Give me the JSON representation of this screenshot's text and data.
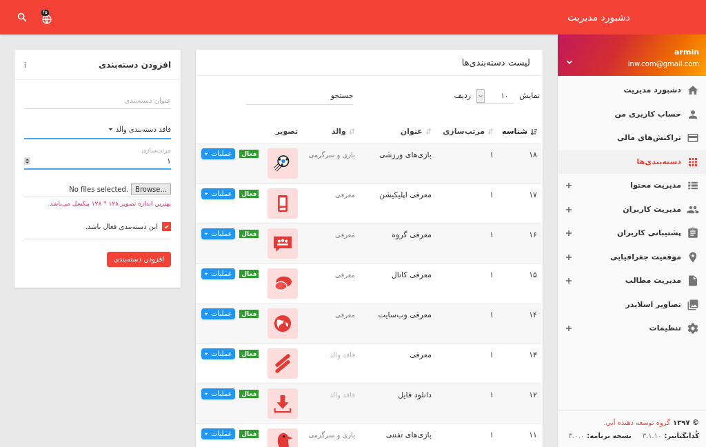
{
  "header": {
    "title": "دشبورد مدیریت",
    "language_badge": "fa"
  },
  "user": {
    "name": "armin",
    "email": "inw.com@gmail.com"
  },
  "menu": [
    {
      "kind": "home",
      "label": "دشبورد مدیریت",
      "expandable": false,
      "selected": false
    },
    {
      "kind": "person",
      "label": "حساب کاربری من",
      "expandable": false,
      "selected": false
    },
    {
      "kind": "card",
      "label": "تراکنش‌های مالی",
      "expandable": false,
      "selected": false
    },
    {
      "kind": "grid",
      "label": "دسته‌بندی‌ها",
      "expandable": false,
      "selected": true
    },
    {
      "kind": "list",
      "label": "مدیریت محتوا",
      "expandable": true,
      "selected": false
    },
    {
      "kind": "people",
      "label": "مدیریت کاربران",
      "expandable": true,
      "selected": false
    },
    {
      "kind": "clipboard",
      "label": "پشتیبانی کاربران",
      "expandable": true,
      "selected": false
    },
    {
      "kind": "pin",
      "label": "موقعیت جغرافیایی",
      "expandable": true,
      "selected": false
    },
    {
      "kind": "file",
      "label": "مدیریت مطالب",
      "expandable": true,
      "selected": false
    },
    {
      "kind": "photos",
      "label": "تصاویر اسلایدر",
      "expandable": false,
      "selected": false
    },
    {
      "kind": "gear",
      "label": "تنظیمات",
      "expandable": true,
      "selected": false
    }
  ],
  "footer": {
    "year": "© ۱۳۹۷",
    "company": "گروه توسعه دهنده آبی.",
    "coder_label": "کُدایگناتیر:",
    "coder_version": "۳.۱.۱۰",
    "version_label": "نسخه برنامه:",
    "version": "۳.۰.۰"
  },
  "list": {
    "title": "لیست دسته‌بندی‌ها",
    "show_label": "نمایش",
    "page_size": "۱۰",
    "rows_label": "ردیف",
    "search_placeholder": "جستجو",
    "columns": [
      {
        "label": "شناسه",
        "sortable": true,
        "sorted": true
      },
      {
        "label": "مرتب‌سازی",
        "sortable": true,
        "sorted": false
      },
      {
        "label": "عنوان",
        "sortable": true,
        "sorted": false
      },
      {
        "label": "والد",
        "sortable": true,
        "sorted": false
      },
      {
        "label": "تصویر",
        "sortable": false,
        "sorted": false
      }
    ],
    "rows": [
      {
        "id": "۱۸",
        "order": "۱",
        "title": "بازی‌های ورزشی",
        "parent": "بازی و سرگرمی",
        "has_parent": true,
        "kind": "ball",
        "status": "فعال",
        "active": true,
        "action": "عملیات"
      },
      {
        "id": "۱۷",
        "order": "۱",
        "title": "معرفی اپلیکیشن",
        "parent": "معرفی",
        "has_parent": true,
        "kind": "phone",
        "status": "فعال",
        "active": true,
        "action": "عملیات"
      },
      {
        "id": "۱۶",
        "order": "۱",
        "title": "معرفی گروه",
        "parent": "معرفی",
        "has_parent": true,
        "kind": "group",
        "status": "فعال",
        "active": true,
        "action": "عملیات"
      },
      {
        "id": "۱۵",
        "order": "۱",
        "title": "معرفی کانال",
        "parent": "معرفی",
        "has_parent": true,
        "kind": "chat",
        "status": "فعال",
        "active": true,
        "action": "عملیات"
      },
      {
        "id": "۱۴",
        "order": "۱",
        "title": "معرفی وب‌سایت",
        "parent": "معرفی",
        "has_parent": true,
        "kind": "globe",
        "status": "فعال",
        "active": true,
        "action": "عملیات"
      },
      {
        "id": "۱۳",
        "order": "۱",
        "title": "معرفی",
        "parent": "فاقد والد",
        "has_parent": false,
        "kind": "stripes",
        "status": "فعال",
        "active": true,
        "action": "عملیات"
      },
      {
        "id": "۱۲",
        "order": "۱",
        "title": "دانلود فایل",
        "parent": "فاقد والد",
        "has_parent": false,
        "kind": "download",
        "status": "فعال",
        "active": true,
        "action": "عملیات"
      },
      {
        "id": "۱۱",
        "order": "۱",
        "title": "بازی‌های تفننی",
        "parent": "بازی و سرگرمی",
        "has_parent": true,
        "kind": "bird",
        "status": "فعال",
        "active": true,
        "action": "عملیات"
      }
    ]
  },
  "form": {
    "title": "افزودن دسته‌بندی",
    "title_placeholder": "عنوان دسته‌بندی",
    "parent_value": "فاقد دسته‌بندی والد",
    "order_label": "مرتب‌سازی",
    "order_value": "۱",
    "browse": "Browse...",
    "no_file": "No files selected.",
    "hint": "بهترین اندازه تصویر ۱۲۸ * ۱۲۸ پیکسل می‌باشد.",
    "active_label": "این دسته‌بندی فعال باشد.",
    "active_checked": true,
    "submit": "افزودن دسته‌بندی"
  }
}
